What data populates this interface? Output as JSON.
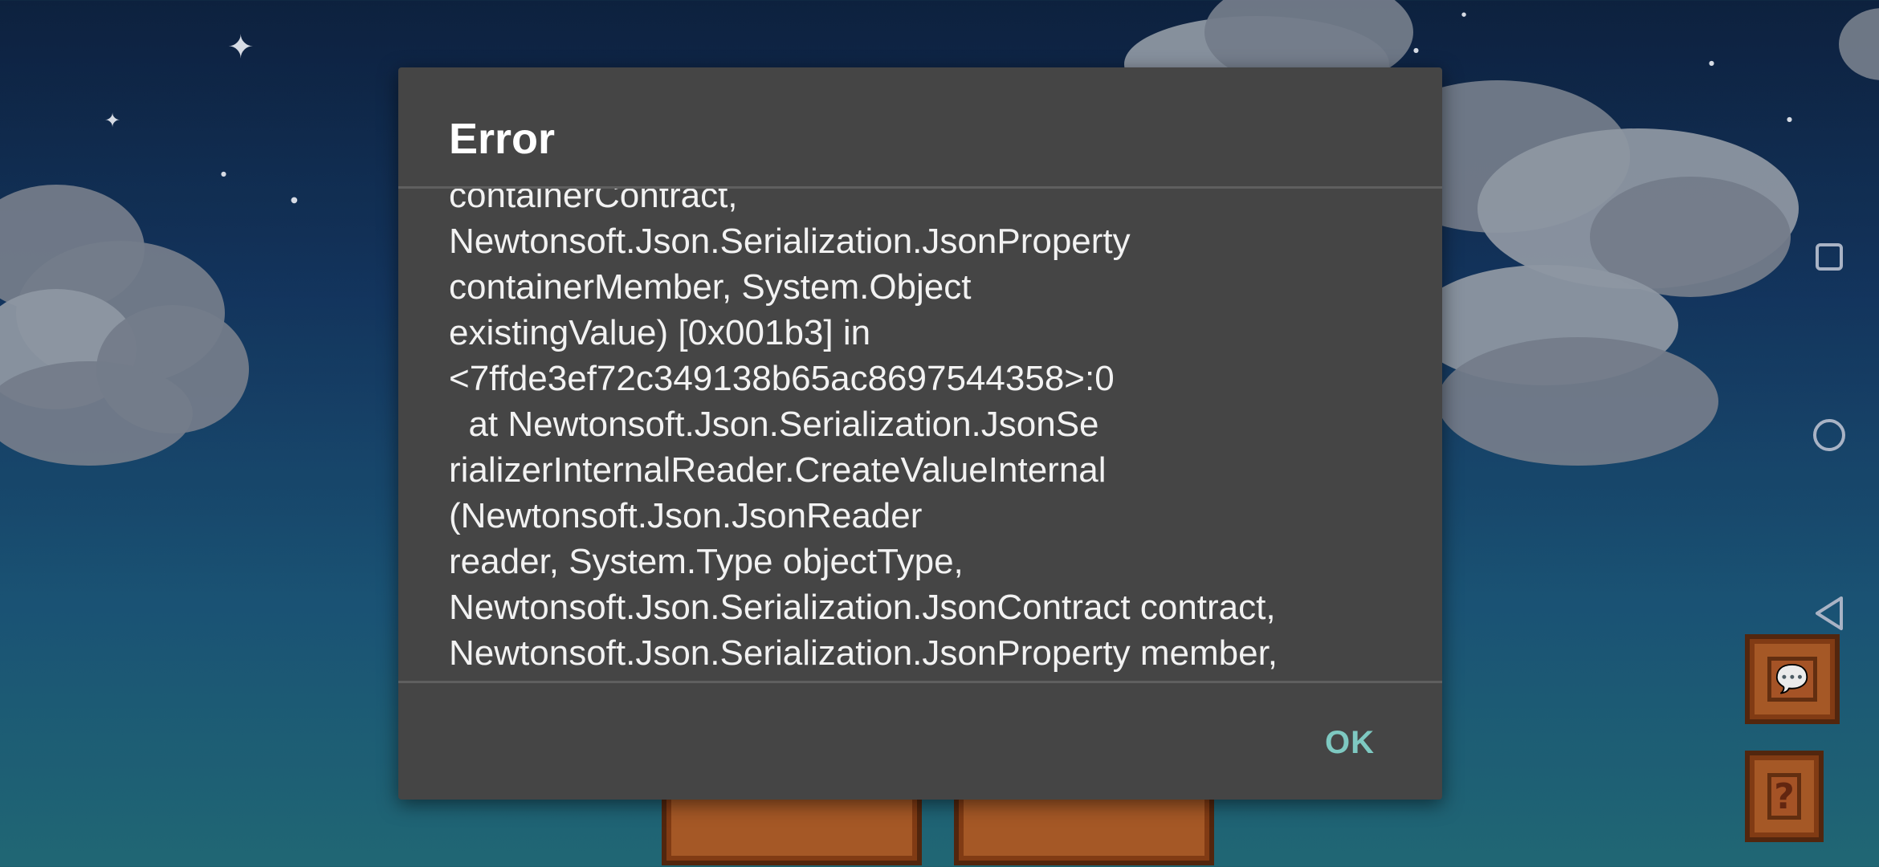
{
  "dialog": {
    "title": "Error",
    "message_lines": [
      "containerContract,",
      "Newtonsoft.Json.Serialization.JsonProperty",
      "containerMember, System.Object",
      "existingValue) [0x001b3] in",
      "<7ffde3ef72c349138b65ac8697544358>:0",
      "  at Newtonsoft.Json.Serialization.JsonSe",
      "rializerInternalReader.CreateValueInternal",
      "(Newtonsoft.Json.JsonReader",
      "reader, System.Type objectType,",
      "Newtonsoft.Json.Serialization.JsonContract contract,",
      "Newtonsoft.Json.Serialization.JsonProperty member,"
    ],
    "ok_label": "OK"
  },
  "game_buttons": {
    "chat_icon": "chat-bubble-icon",
    "help_label": "?"
  },
  "nav_bar": {
    "items": [
      "recents-icon",
      "home-icon",
      "back-icon"
    ]
  },
  "colors": {
    "dialog_bg": "#454545",
    "accent": "#7ec9c1",
    "sky_top": "#0f2444",
    "sky_bottom": "#23707e"
  }
}
